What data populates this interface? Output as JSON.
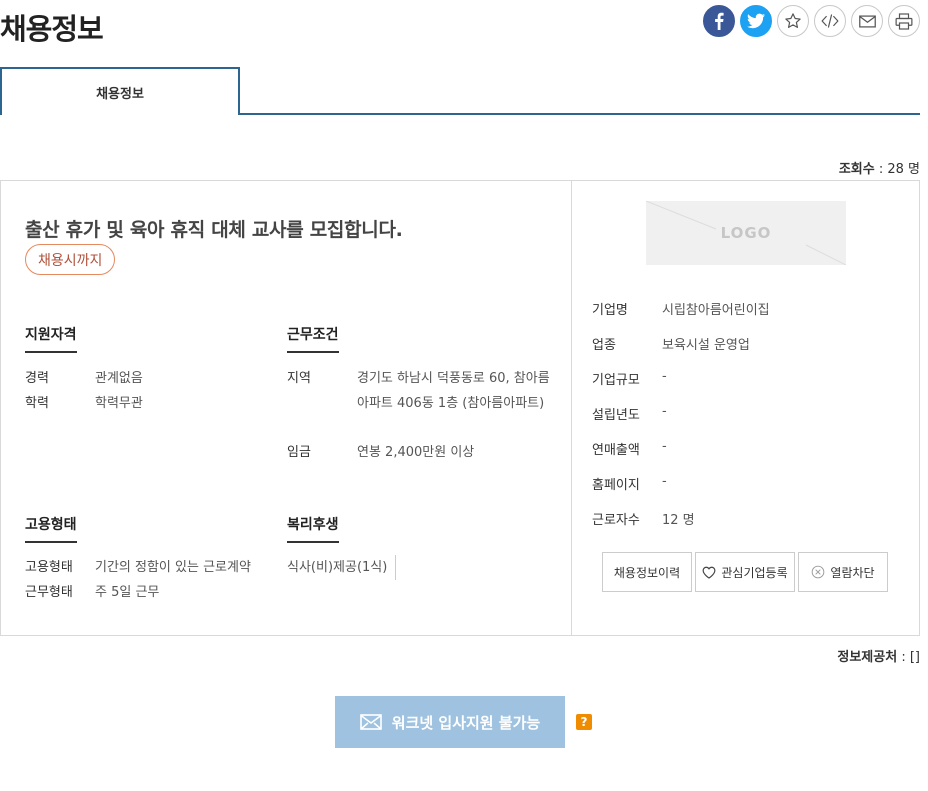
{
  "header": {
    "title": "채용정보"
  },
  "share": {
    "facebook": "facebook-icon",
    "twitter": "twitter-icon",
    "bookmark": "star-icon",
    "embed": "code-icon",
    "email": "mail-icon",
    "print": "print-icon"
  },
  "tabs": [
    {
      "label": "채용정보",
      "active": true
    }
  ],
  "views": {
    "label": "조회수",
    "sep": " : ",
    "value": "28 명"
  },
  "job": {
    "title": "출산 휴가 및 육아 휴직 대체 교사를 모집합니다.",
    "deadline_badge": "채용시까지",
    "qualifications": {
      "heading": "지원자격",
      "rows": [
        {
          "key": "경력",
          "value": "관계없음"
        },
        {
          "key": "학력",
          "value": "학력무관"
        }
      ]
    },
    "conditions": {
      "heading": "근무조건",
      "rows": [
        {
          "key": "지역",
          "value": "경기도 하남시 덕풍동로 60, 참아름 아파트 406동 1층 (참아름아파트)"
        },
        {
          "key": "임금",
          "value": "연봉 2,400만원 이상"
        }
      ]
    },
    "employment": {
      "heading": "고용형태",
      "rows": [
        {
          "key": "고용형태",
          "value": "기간의 정함이 있는 근로계약"
        },
        {
          "key": "근무형태",
          "value": "주 5일 근무"
        }
      ]
    },
    "welfare": {
      "heading": "복리후생",
      "value": "식사(비)제공(1식)"
    }
  },
  "company": {
    "logo_text": "LOGO",
    "rows": [
      {
        "key": "기업명",
        "value": "시립참아름어린이집"
      },
      {
        "key": "업종",
        "value": "보육시설 운영업"
      },
      {
        "key": "기업규모",
        "value": "-"
      },
      {
        "key": "설립년도",
        "value": "-"
      },
      {
        "key": "연매출액",
        "value": "-"
      },
      {
        "key": "홈페이지",
        "value": "-"
      },
      {
        "key": "근로자수",
        "value": "12 명"
      }
    ],
    "actions": {
      "history": "채용정보이력",
      "favorite": "관심기업등록",
      "block": "열람차단"
    }
  },
  "source": {
    "label": "정보제공처",
    "sep": " : ",
    "value": "[]"
  },
  "apply": {
    "label": "워크넷 입사지원 불가능",
    "help": "?"
  },
  "colors": {
    "accent": "#2b6590",
    "badge_border": "#e58a5f",
    "apply_bg": "#9ec2e0",
    "help_bg": "#f08c00",
    "facebook": "#3a5897",
    "twitter": "#1da1f2"
  }
}
